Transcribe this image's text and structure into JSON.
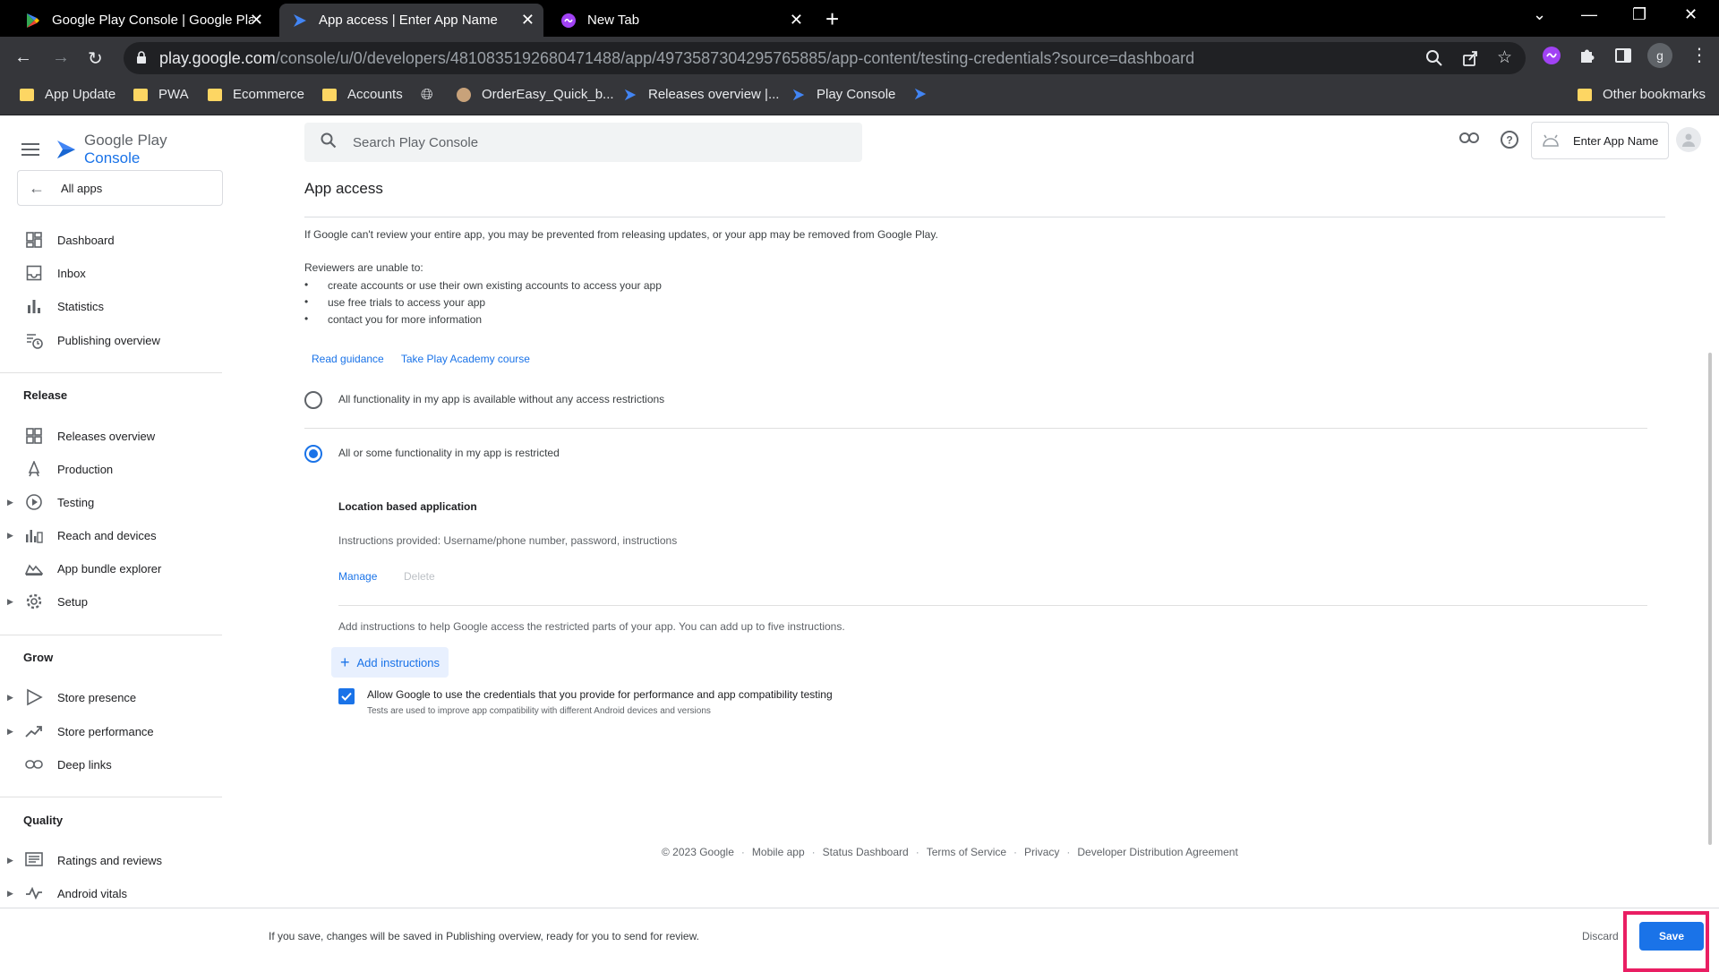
{
  "browser": {
    "tabs": [
      {
        "title": "Google Play Console | Google Play"
      },
      {
        "title": "App access | Enter App Name"
      },
      {
        "title": "New Tab"
      }
    ],
    "url_host": "play.google.com",
    "url_path": "/console/u/0/developers/4810835192680471488/app/4973587304295765885/app-content/testing-credentials?source=dashboard",
    "profile_initial": "g",
    "bookmarks": [
      {
        "label": "App Update"
      },
      {
        "label": "PWA"
      },
      {
        "label": "Ecommerce"
      },
      {
        "label": "Accounts"
      },
      {
        "label": "OrderEasy_Quick_b..."
      },
      {
        "label": "Releases overview |..."
      },
      {
        "label": "Play Console"
      }
    ],
    "other_bookmarks": "Other bookmarks"
  },
  "console": {
    "logo_google_play": "Google Play",
    "logo_console": "Console",
    "all_apps": "All apps",
    "search_placeholder": "Search Play Console",
    "app_name": "Enter App Name",
    "nav": {
      "top": [
        {
          "label": "Dashboard",
          "icon": "dashboard-icon"
        },
        {
          "label": "Inbox",
          "icon": "inbox-icon"
        },
        {
          "label": "Statistics",
          "icon": "statistics-icon"
        },
        {
          "label": "Publishing overview",
          "icon": "publishing-icon"
        }
      ],
      "release_title": "Release",
      "release": [
        {
          "label": "Releases overview"
        },
        {
          "label": "Production"
        },
        {
          "label": "Testing"
        },
        {
          "label": "Reach and devices"
        },
        {
          "label": "App bundle explorer"
        },
        {
          "label": "Setup"
        }
      ],
      "grow_title": "Grow",
      "grow": [
        {
          "label": "Store presence"
        },
        {
          "label": "Store performance"
        },
        {
          "label": "Deep links"
        }
      ],
      "quality_title": "Quality",
      "quality": [
        {
          "label": "Ratings and reviews"
        },
        {
          "label": "Android vitals"
        }
      ]
    }
  },
  "content": {
    "title": "App access",
    "intro": "If Google can't review your entire app, you may be prevented from releasing updates, or your app may be removed from Google Play.",
    "reviewers_heading": "Reviewers are unable to:",
    "bullets": [
      "create accounts or use their own existing accounts to access your app",
      "use free trials to access your app",
      "contact you for more information"
    ],
    "link_guidance": "Read guidance",
    "link_academy": "Take Play Academy course",
    "option_all": "All functionality in my app is available without any access restrictions",
    "option_restricted": "All or some functionality in my app is restricted",
    "instruction_title": "Location based application",
    "instruction_text": "Instructions provided: Username/phone number, password, instructions",
    "manage": "Manage",
    "delete": "Delete",
    "add_help": "Add instructions to help Google access the restricted parts of your app. You can add up to five instructions.",
    "add_button": "Add instructions",
    "checkbox_label": "Allow Google to use the credentials that you provide for performance and app compatibility testing",
    "checkbox_sub": "Tests are used to improve app compatibility with different Android devices and versions"
  },
  "footer": {
    "copyright": "© 2023 Google",
    "links": [
      "Mobile app",
      "Status Dashboard",
      "Terms of Service",
      "Privacy",
      "Developer Distribution Agreement"
    ]
  },
  "bottom_bar": {
    "text": "If you save, changes will be saved in Publishing overview, ready for you to send for review.",
    "discard": "Discard",
    "save": "Save"
  },
  "colors": {
    "accent": "#1a73e8",
    "highlight": "#e91e63"
  }
}
